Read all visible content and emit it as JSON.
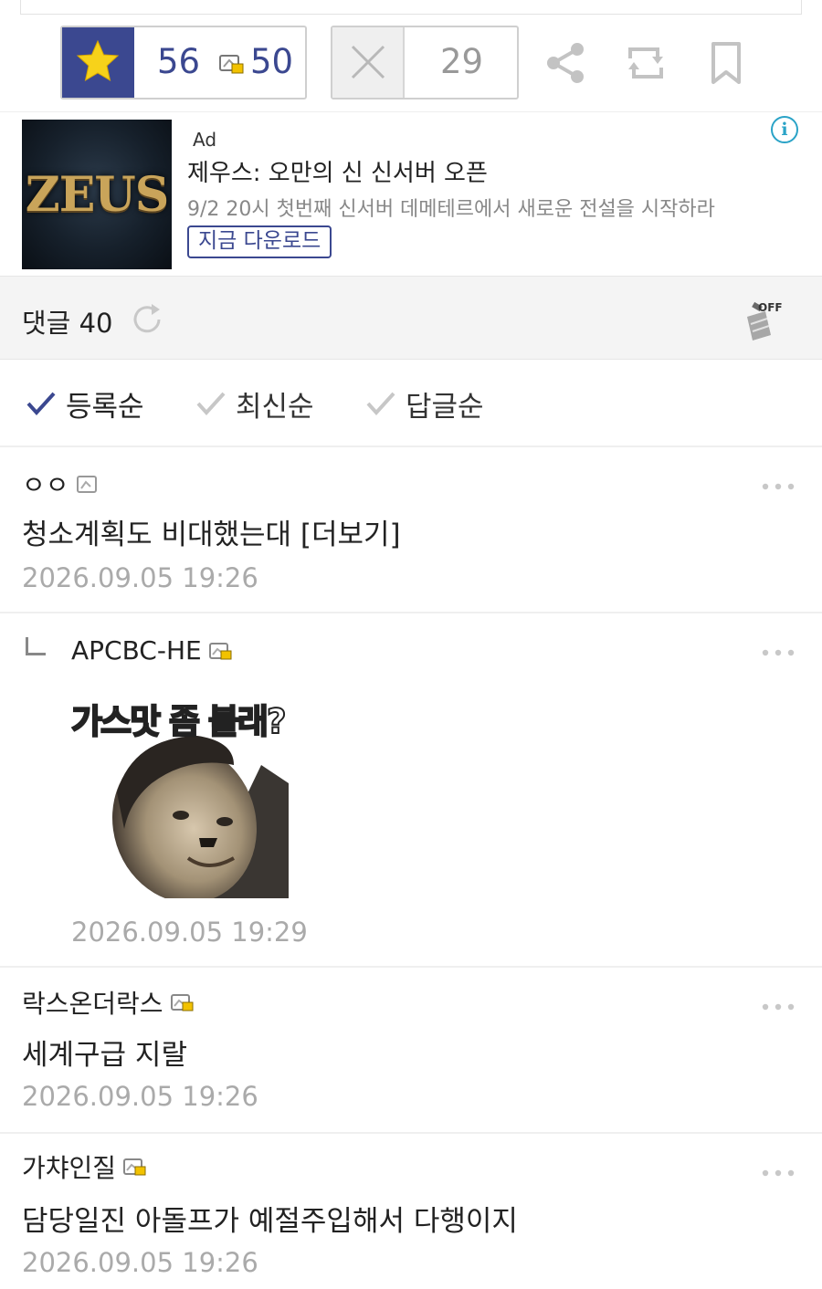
{
  "actions": {
    "recommend_count": "56",
    "fixed_recommend_count": "50",
    "nonrecommend_count": "29",
    "icons": [
      "star-icon",
      "fixed-user-icon",
      "close-icon",
      "share-icon",
      "repost-icon",
      "bookmark-icon"
    ],
    "accent_color": "#3b4890"
  },
  "ad": {
    "label": "Ad",
    "thumbnail_text": "ZEUS",
    "title": "제우스: 오만의 신 신서버 오픈",
    "description": "9/2 20시 첫번째 신서버 데메테르에서 새로운 전설을 시작하라",
    "cta": "지금 다운로드",
    "info_icon_text": "i"
  },
  "comments_header": {
    "title": "댓글 40",
    "cleaner_badge": "OFF"
  },
  "sort_tabs": [
    {
      "label": "등록순",
      "active": true
    },
    {
      "label": "최신순",
      "active": false
    },
    {
      "label": "답글순",
      "active": false
    }
  ],
  "comments": [
    {
      "author": "ㅇㅇ",
      "body": "청소계획도 비대했는대 [더보기]",
      "date": "2026.09.05 19:26"
    },
    {
      "author": "APCBC-HE",
      "dccon_caption": "가스맛 좀 볼래?",
      "date": "2026.09.05 19:29",
      "reply": true
    },
    {
      "author": "락스온더락스",
      "body": "세계구급 지랄",
      "date": "2026.09.05 19:26"
    },
    {
      "author": "가챠인질",
      "body": "담당일진 아돌프가 예절주입해서 다행이지",
      "date": "2026.09.05 19:26"
    }
  ]
}
